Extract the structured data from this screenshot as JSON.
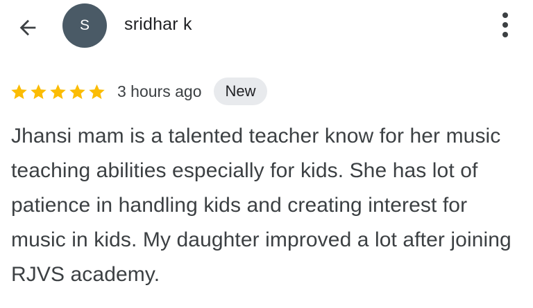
{
  "header": {
    "back_icon": "arrow-left-icon",
    "avatar_initial": "S",
    "avatar_color": "#4a5a66",
    "author_name": "sridhar k",
    "more_icon": "more-vert-icon"
  },
  "review": {
    "rating": 5,
    "max_rating": 5,
    "star_color": "#fbbc04",
    "time_ago": "3 hours ago",
    "badge": "New",
    "text": "Jhansi mam is a talented teacher know for her music teaching abilities especially for kids. She has lot of patience in handling kids and creating interest for music in kids. My daughter improved a lot after joining RJVS academy."
  }
}
